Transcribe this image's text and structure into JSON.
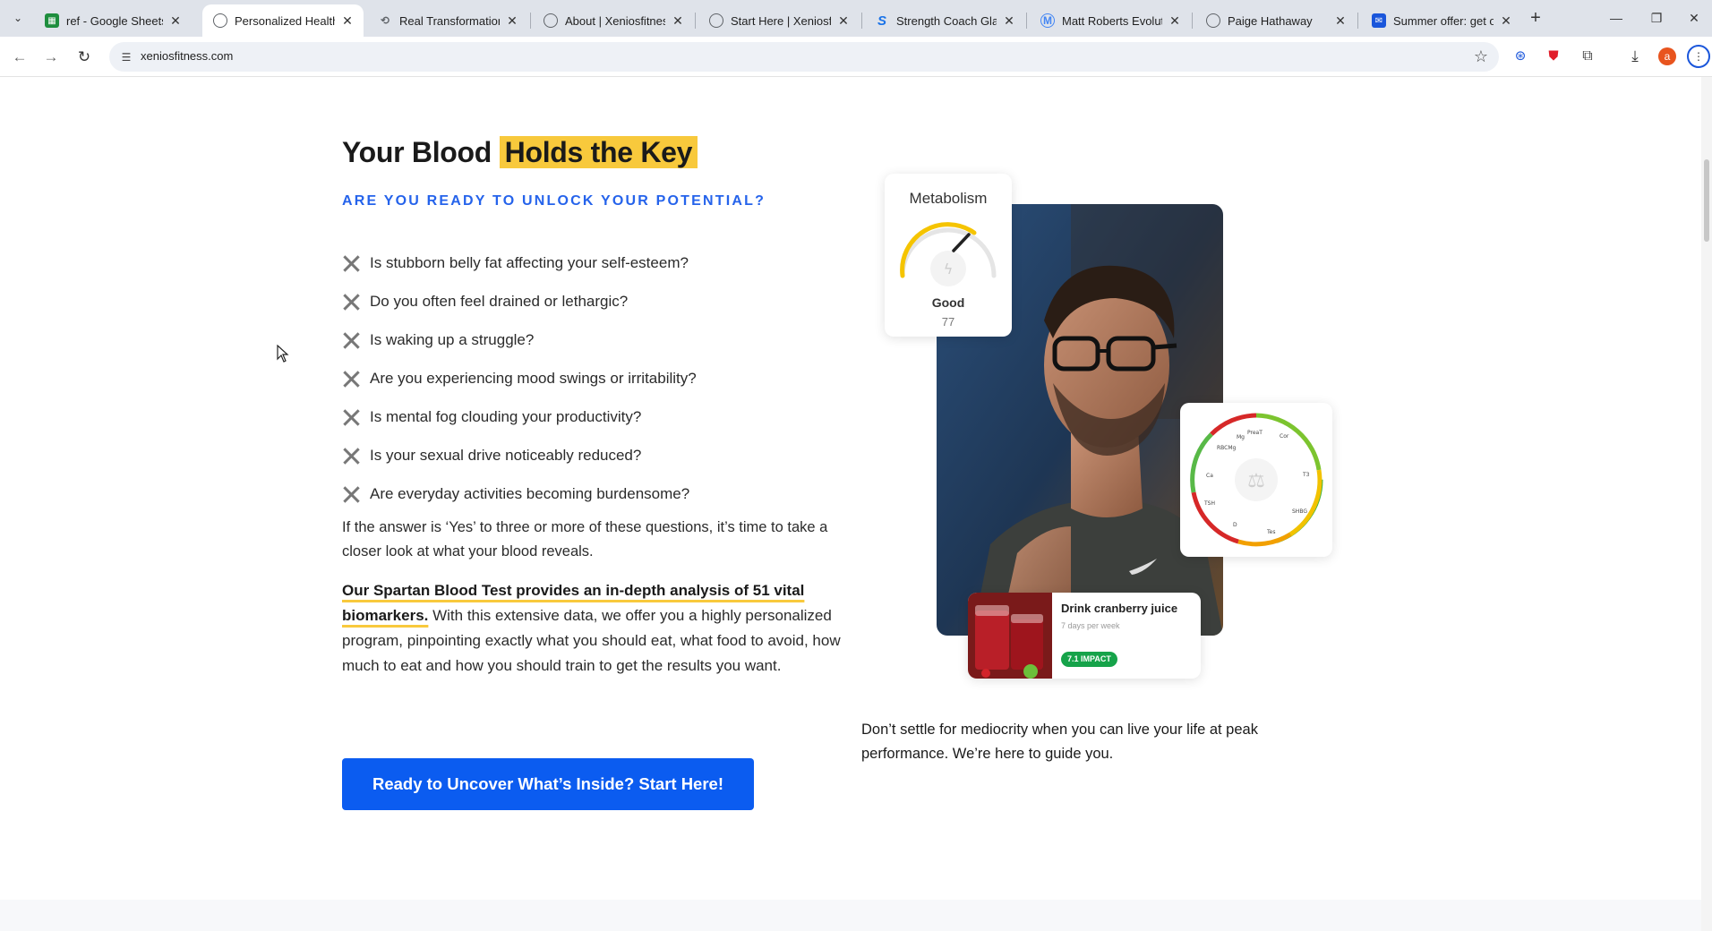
{
  "browser": {
    "tabs": [
      {
        "title": "ref - Google Sheets",
        "icon": "sheets-icon",
        "color": "#1e8e3e",
        "active": false
      },
      {
        "title": "Personalized Health C",
        "icon": "globe-icon",
        "color": "#5f6368",
        "active": true
      },
      {
        "title": "Real Transformations",
        "icon": "link-icon",
        "color": "#5f6368",
        "active": false
      },
      {
        "title": "About | Xeniosfitness",
        "icon": "globe-icon",
        "color": "#5f6368",
        "active": false
      },
      {
        "title": "Start Here | Xeniosfitn",
        "icon": "globe-icon",
        "color": "#5f6368",
        "active": false
      },
      {
        "title": "Strength Coach Glasg",
        "icon": "s-brand-icon",
        "color": "#1a73e8",
        "active": false
      },
      {
        "title": "Matt Roberts Evolutic",
        "icon": "m-brand-icon",
        "color": "#4285f4",
        "active": false
      },
      {
        "title": "Paige Hathaway",
        "icon": "globe-icon",
        "color": "#5f6368",
        "active": false
      },
      {
        "title": "Summer offer: get on",
        "icon": "chat-icon",
        "color": "#1a56db",
        "active": false
      }
    ],
    "url": "xeniosfitness.com",
    "profile_initial": "a"
  },
  "hero": {
    "headline_prefix": "Your Blood ",
    "headline_highlight": "Holds the Key",
    "subhead": "ARE YOU READY TO UNLOCK YOUR POTENTIAL?",
    "questions": [
      "Is stubborn belly fat affecting your self-esteem?",
      "Do you often feel drained or lethargic?",
      "Is waking up a struggle?",
      "Are you experiencing mood swings or irritability?",
      "Is mental fog clouding your productivity?",
      "Is your sexual drive noticeably reduced?",
      "Are everyday activities becoming burdensome?"
    ],
    "para1": "If the answer is ‘Yes’ to three or more of these questions, it’s time to take a closer look at what your blood reveals.",
    "para2_strong": "Our Spartan Blood Test provides an in-depth analysis of 51 vital biomarkers.",
    "para2_rest": " With this extensive data, we offer you a highly personalized program, pinpointing exactly what you should eat, what food to avoid, how much to eat and how you should train to get the results you want.",
    "cta_label": "Ready to Uncover What’s Inside? Start Here!",
    "tagline": "Don’t settle for mediocrity when you can live your life at peak performance. We’re here to guide you."
  },
  "metabolism_card": {
    "title": "Metabolism",
    "status": "Good",
    "value": "77",
    "accent": "#f5c400"
  },
  "biomarker_wheel": {
    "labels": [
      "Mg",
      "PreaT",
      "Cor",
      "T3",
      "SHBG",
      "Tes",
      "D",
      "TSH",
      "Ca",
      "RBCMg"
    ]
  },
  "juice_card": {
    "title": "Drink cranberry juice",
    "subtitle": "7 days per week",
    "badge": "7.1 IMPACT",
    "badge_color": "#16a34a"
  },
  "colors": {
    "accent_yellow": "#f8c93c",
    "brand_blue": "#0b5cf0",
    "subhead_blue": "#2563eb"
  }
}
